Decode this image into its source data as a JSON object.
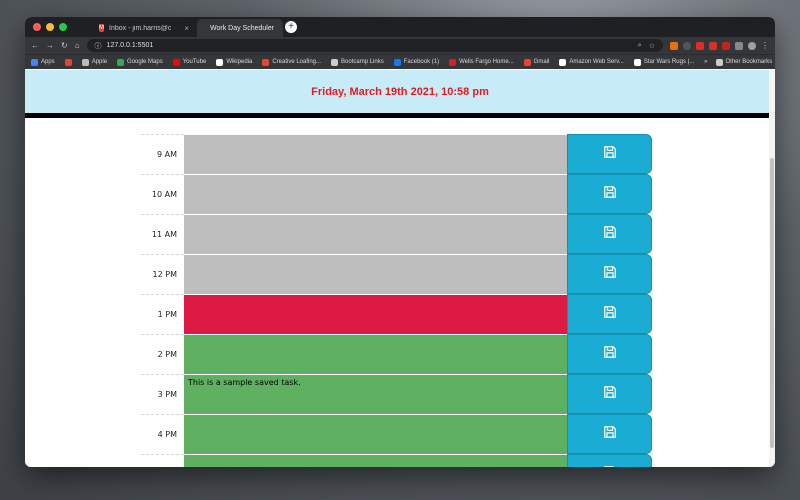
{
  "browser": {
    "tabs": [
      {
        "title": "Inbox - jim.harris@creativeloaf...",
        "favicon": "gmail-icon",
        "active": false
      },
      {
        "title": "Work Day Scheduler",
        "favicon": "globe-icon",
        "active": true
      }
    ],
    "new_tab_symbol": "+",
    "url": "127.0.0.1:5501",
    "bookmarks": [
      {
        "label": "Apps",
        "icon": "apps-grid-icon",
        "color": "#4285f4"
      },
      {
        "label": "",
        "icon": "gmail-icon",
        "color": "#ea4335"
      },
      {
        "label": "Apple",
        "icon": "apple-icon",
        "color": "#bbbbbb"
      },
      {
        "label": "Google Maps",
        "icon": "google-maps-icon",
        "color": "#34a853"
      },
      {
        "label": "YouTube",
        "icon": "youtube-icon",
        "color": "#ff0000"
      },
      {
        "label": "Wikipedia",
        "icon": "wikipedia-icon",
        "color": "#ffffff"
      },
      {
        "label": "Creative Loafing...",
        "icon": "gmail-icon",
        "color": "#ea4335"
      },
      {
        "label": "Bootcamp Links",
        "icon": "folder-icon",
        "color": "#cccccc"
      },
      {
        "label": "Facebook (1)",
        "icon": "facebook-icon",
        "color": "#1877f2"
      },
      {
        "label": "Wells Fargo Home...",
        "icon": "wells-fargo-icon",
        "color": "#d71e28"
      },
      {
        "label": "Gmail",
        "icon": "gmail-icon",
        "color": "#ea4335"
      },
      {
        "label": "Amazon Web Serv...",
        "icon": "aws-icon",
        "color": "#ffffff"
      },
      {
        "label": "Star Wars Rugs |...",
        "icon": "globe-icon",
        "color": "#ffffff"
      }
    ],
    "bookmarks_overflow": "»",
    "other_bookmarks": "Other Bookmarks"
  },
  "header": {
    "current_day": "Friday, March 19th 2021, 10:58 pm"
  },
  "scheduler": {
    "rows": [
      {
        "hour": "9 AM",
        "state": "past",
        "task": ""
      },
      {
        "hour": "10 AM",
        "state": "past",
        "task": ""
      },
      {
        "hour": "11 AM",
        "state": "past",
        "task": ""
      },
      {
        "hour": "12 PM",
        "state": "past",
        "task": ""
      },
      {
        "hour": "1 PM",
        "state": "present",
        "task": ""
      },
      {
        "hour": "2 PM",
        "state": "future",
        "task": ""
      },
      {
        "hour": "3 PM",
        "state": "future",
        "task": "This is a sample saved task."
      },
      {
        "hour": "4 PM",
        "state": "future",
        "task": ""
      },
      {
        "hour": "",
        "state": "future",
        "task": ""
      }
    ],
    "save_icon": "floppy-disk-icon"
  },
  "colors": {
    "past": "#bdbdbd",
    "present": "#dc1a44",
    "future": "#5fb161",
    "save_button": "#1bacd4",
    "jumbotron": "#c7ecf7",
    "current_day_text": "#e31b23"
  }
}
